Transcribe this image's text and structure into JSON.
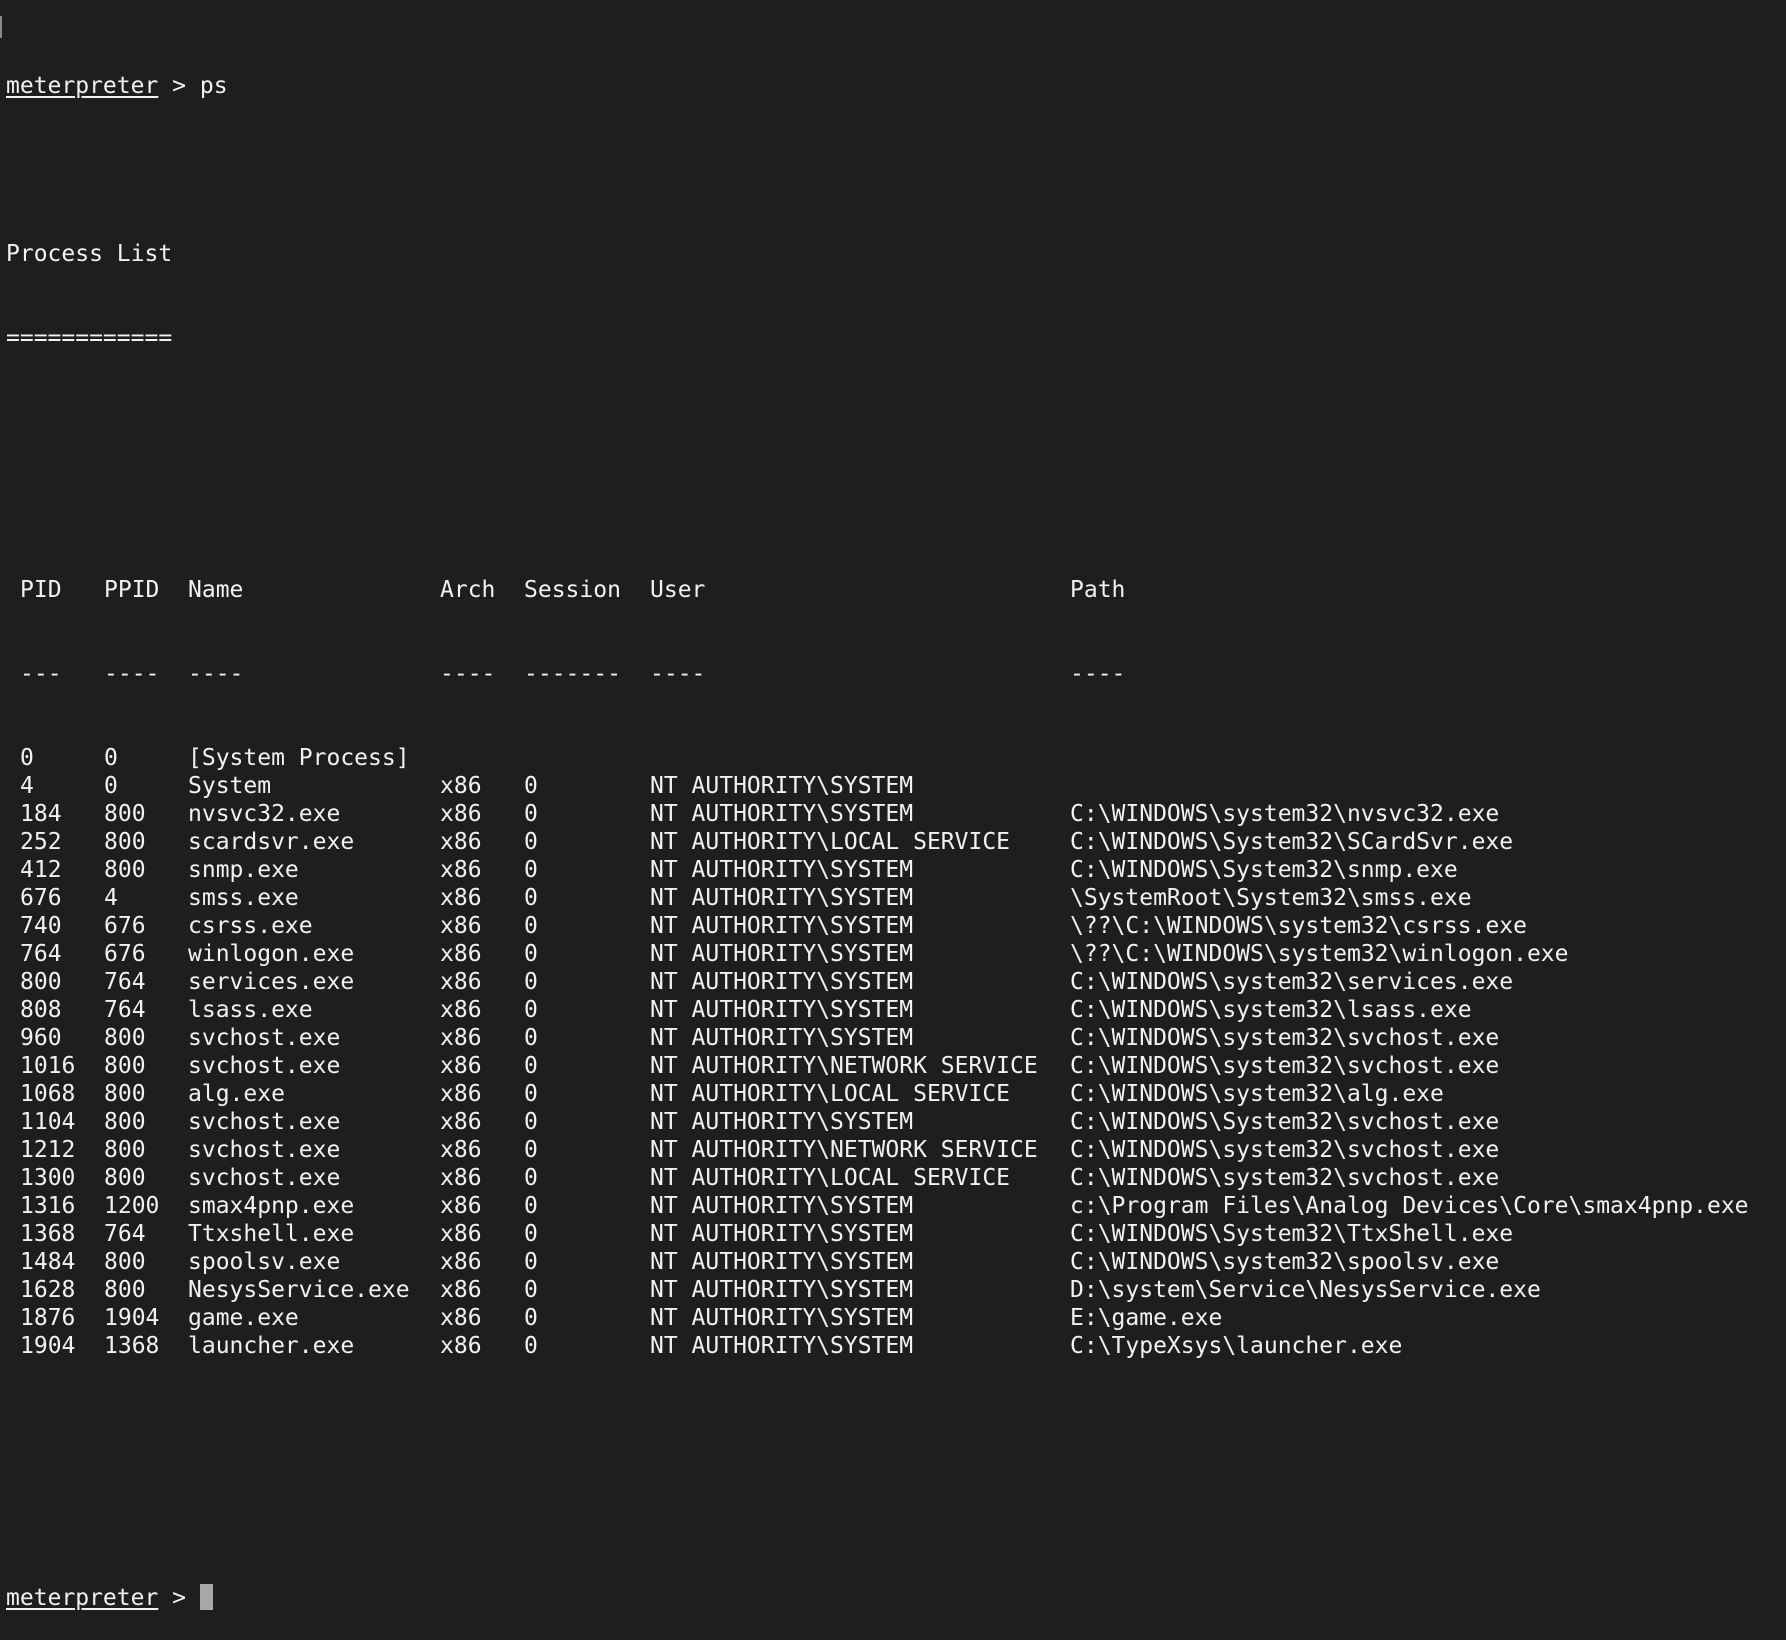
{
  "terminal": {
    "prompt_word": "meterpreter",
    "prompt_sep": " > ",
    "command": "ps",
    "title": "Process List",
    "title_rule": "============",
    "headers": {
      "pid": "PID",
      "ppid": "PPID",
      "name": "Name",
      "arch": "Arch",
      "session": "Session",
      "user": "User",
      "path": "Path"
    },
    "dividers": {
      "pid": "---",
      "ppid": "----",
      "name": "----",
      "arch": "----",
      "session": "-------",
      "user": "----",
      "path": "----"
    },
    "rows": [
      {
        "pid": "0",
        "ppid": "0",
        "name": "[System Process]",
        "arch": "",
        "session": "",
        "user": "",
        "path": ""
      },
      {
        "pid": "4",
        "ppid": "0",
        "name": "System",
        "arch": "x86",
        "session": "0",
        "user": "NT AUTHORITY\\SYSTEM",
        "path": ""
      },
      {
        "pid": "184",
        "ppid": "800",
        "name": "nvsvc32.exe",
        "arch": "x86",
        "session": "0",
        "user": "NT AUTHORITY\\SYSTEM",
        "path": "C:\\WINDOWS\\system32\\nvsvc32.exe"
      },
      {
        "pid": "252",
        "ppid": "800",
        "name": "scardsvr.exe",
        "arch": "x86",
        "session": "0",
        "user": "NT AUTHORITY\\LOCAL SERVICE",
        "path": "C:\\WINDOWS\\System32\\SCardSvr.exe"
      },
      {
        "pid": "412",
        "ppid": "800",
        "name": "snmp.exe",
        "arch": "x86",
        "session": "0",
        "user": "NT AUTHORITY\\SYSTEM",
        "path": "C:\\WINDOWS\\System32\\snmp.exe"
      },
      {
        "pid": "676",
        "ppid": "4",
        "name": "smss.exe",
        "arch": "x86",
        "session": "0",
        "user": "NT AUTHORITY\\SYSTEM",
        "path": "\\SystemRoot\\System32\\smss.exe"
      },
      {
        "pid": "740",
        "ppid": "676",
        "name": "csrss.exe",
        "arch": "x86",
        "session": "0",
        "user": "NT AUTHORITY\\SYSTEM",
        "path": "\\??\\C:\\WINDOWS\\system32\\csrss.exe"
      },
      {
        "pid": "764",
        "ppid": "676",
        "name": "winlogon.exe",
        "arch": "x86",
        "session": "0",
        "user": "NT AUTHORITY\\SYSTEM",
        "path": "\\??\\C:\\WINDOWS\\system32\\winlogon.exe"
      },
      {
        "pid": "800",
        "ppid": "764",
        "name": "services.exe",
        "arch": "x86",
        "session": "0",
        "user": "NT AUTHORITY\\SYSTEM",
        "path": "C:\\WINDOWS\\system32\\services.exe"
      },
      {
        "pid": "808",
        "ppid": "764",
        "name": "lsass.exe",
        "arch": "x86",
        "session": "0",
        "user": "NT AUTHORITY\\SYSTEM",
        "path": "C:\\WINDOWS\\system32\\lsass.exe"
      },
      {
        "pid": "960",
        "ppid": "800",
        "name": "svchost.exe",
        "arch": "x86",
        "session": "0",
        "user": "NT AUTHORITY\\SYSTEM",
        "path": "C:\\WINDOWS\\system32\\svchost.exe"
      },
      {
        "pid": "1016",
        "ppid": "800",
        "name": "svchost.exe",
        "arch": "x86",
        "session": "0",
        "user": "NT AUTHORITY\\NETWORK SERVICE",
        "path": "C:\\WINDOWS\\system32\\svchost.exe"
      },
      {
        "pid": "1068",
        "ppid": "800",
        "name": "alg.exe",
        "arch": "x86",
        "session": "0",
        "user": "NT AUTHORITY\\LOCAL SERVICE",
        "path": "C:\\WINDOWS\\system32\\alg.exe"
      },
      {
        "pid": "1104",
        "ppid": "800",
        "name": "svchost.exe",
        "arch": "x86",
        "session": "0",
        "user": "NT AUTHORITY\\SYSTEM",
        "path": "C:\\WINDOWS\\System32\\svchost.exe"
      },
      {
        "pid": "1212",
        "ppid": "800",
        "name": "svchost.exe",
        "arch": "x86",
        "session": "0",
        "user": "NT AUTHORITY\\NETWORK SERVICE",
        "path": "C:\\WINDOWS\\system32\\svchost.exe"
      },
      {
        "pid": "1300",
        "ppid": "800",
        "name": "svchost.exe",
        "arch": "x86",
        "session": "0",
        "user": "NT AUTHORITY\\LOCAL SERVICE",
        "path": "C:\\WINDOWS\\system32\\svchost.exe"
      },
      {
        "pid": "1316",
        "ppid": "1200",
        "name": "smax4pnp.exe",
        "arch": "x86",
        "session": "0",
        "user": "NT AUTHORITY\\SYSTEM",
        "path": "c:\\Program Files\\Analog Devices\\Core\\smax4pnp.exe"
      },
      {
        "pid": "1368",
        "ppid": "764",
        "name": "Ttxshell.exe",
        "arch": "x86",
        "session": "0",
        "user": "NT AUTHORITY\\SYSTEM",
        "path": "C:\\WINDOWS\\System32\\TtxShell.exe"
      },
      {
        "pid": "1484",
        "ppid": "800",
        "name": "spoolsv.exe",
        "arch": "x86",
        "session": "0",
        "user": "NT AUTHORITY\\SYSTEM",
        "path": "C:\\WINDOWS\\system32\\spoolsv.exe"
      },
      {
        "pid": "1628",
        "ppid": "800",
        "name": "NesysService.exe",
        "arch": "x86",
        "session": "0",
        "user": "NT AUTHORITY\\SYSTEM",
        "path": "D:\\system\\Service\\NesysService.exe"
      },
      {
        "pid": "1876",
        "ppid": "1904",
        "name": "game.exe",
        "arch": "x86",
        "session": "0",
        "user": "NT AUTHORITY\\SYSTEM",
        "path": "E:\\game.exe"
      },
      {
        "pid": "1904",
        "ppid": "1368",
        "name": "launcher.exe",
        "arch": "x86",
        "session": "0",
        "user": "NT AUTHORITY\\SYSTEM",
        "path": "C:\\TypeXsys\\launcher.exe"
      }
    ]
  },
  "colors": {
    "background": "#1e1e1e",
    "foreground": "#f2f2f2",
    "cursor": "#a8a8a8"
  }
}
